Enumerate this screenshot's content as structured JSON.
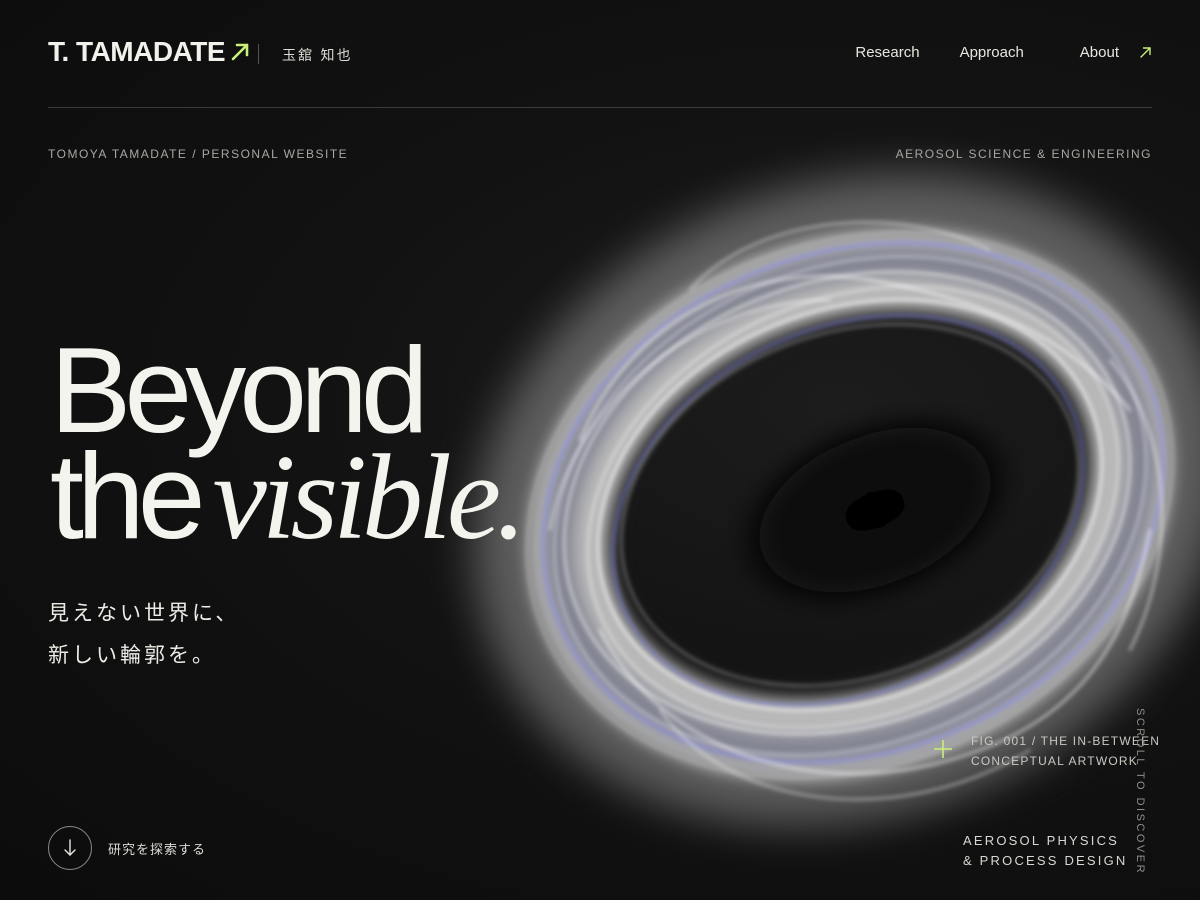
{
  "header": {
    "logo_text": "T. TAMADATE",
    "logo_arrow_icon": "arrow-up-right-icon",
    "name_jp": "玉舘 知也",
    "nav": [
      {
        "label": "Research"
      },
      {
        "label": "Approach"
      },
      {
        "label": "About"
      }
    ],
    "nav_arrow_icon": "arrow-up-right-icon"
  },
  "subheader": {
    "left": "TOMOYA TAMADATE / PERSONAL WEBSITE",
    "right": "AEROSOL SCIENCE & ENGINEERING"
  },
  "hero": {
    "line1": "Beyond",
    "line2_plain": "the",
    "line2_italic": "visible.",
    "jp_line1": "見えない世界に、",
    "jp_line2": "新しい輪郭を。"
  },
  "figure": {
    "icon": "plus-icon",
    "caption_line1": "FIG. 001 / THE IN-BETWEEN",
    "caption_line2": "CONCEPTUAL ARTWORK"
  },
  "field": {
    "line1": "AEROSOL PHYSICS",
    "line2": "& PROCESS DESIGN"
  },
  "scroll_hint": "SCROLL TO DISCOVER",
  "cta": {
    "icon": "arrow-down-icon",
    "label": "研究を探索する"
  },
  "colors": {
    "background": "#0e0e0e",
    "text": "#f4f4ee",
    "accent": "#c8f07a",
    "muted": "#a7a7a2"
  }
}
